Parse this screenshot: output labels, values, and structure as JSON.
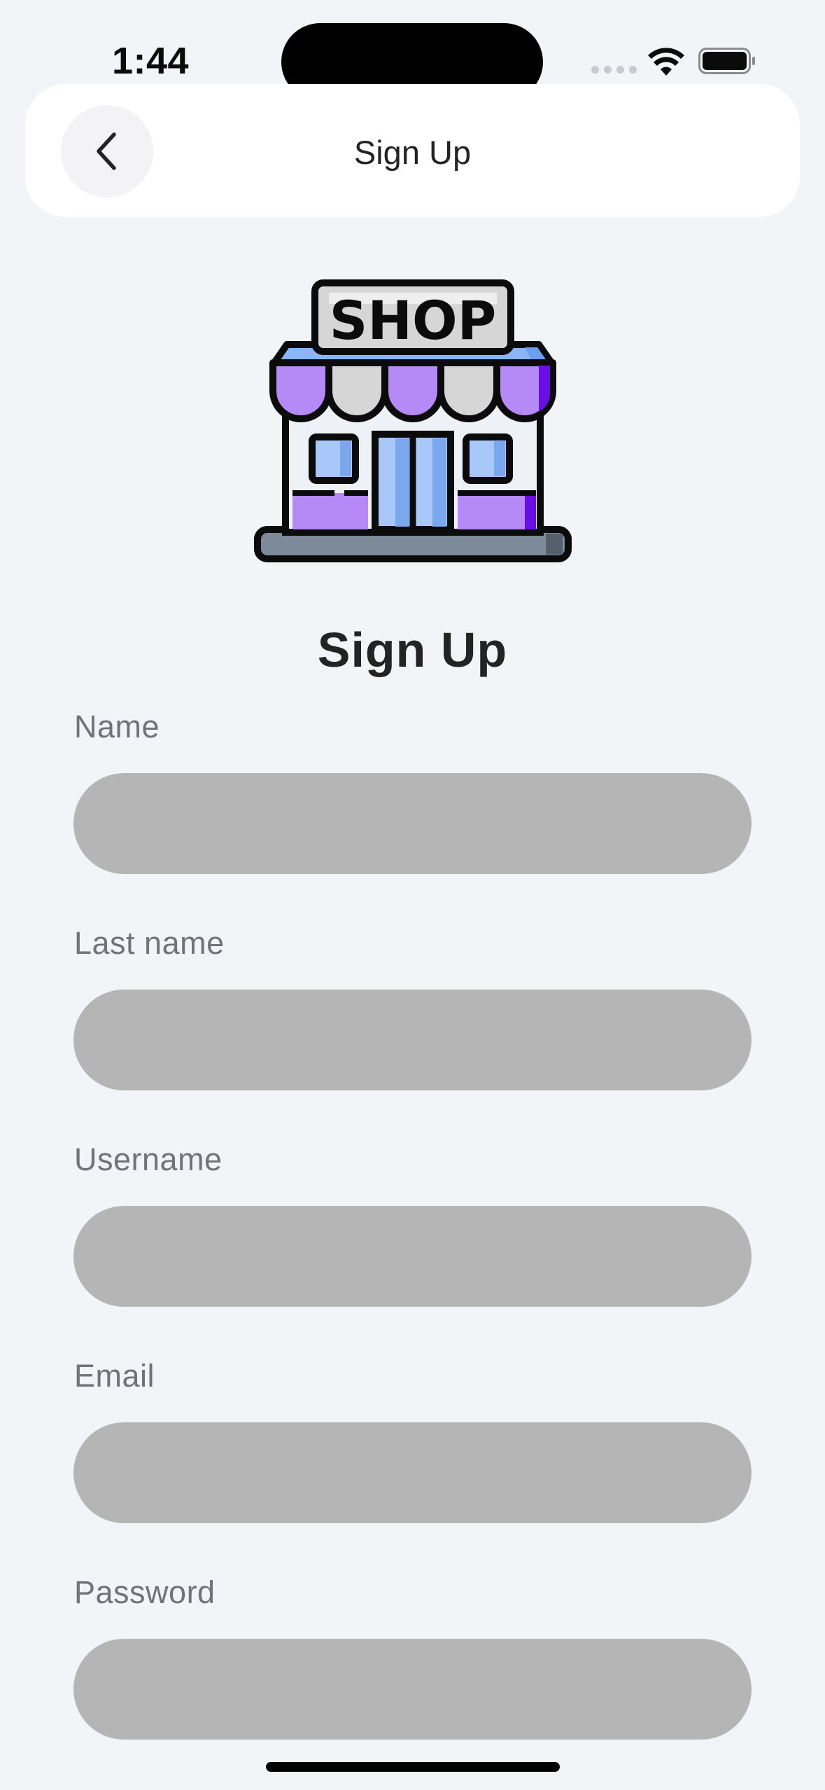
{
  "status_bar": {
    "time": "1:44"
  },
  "header": {
    "title": "Sign Up",
    "back_icon": "chevron-left-icon"
  },
  "logo": {
    "sign_text": "SHOP",
    "colors": {
      "awning_purple": "#b58af7",
      "awning_gray": "#d6d6d6",
      "roof_blue": "#8ab6f7",
      "window_blue": "#a7c8f8",
      "base_gray": "#7d8a99",
      "accent_violet": "#6a0ee8"
    }
  },
  "form": {
    "title": "Sign Up",
    "fields": [
      {
        "label": "Name",
        "value": ""
      },
      {
        "label": "Last name",
        "value": ""
      },
      {
        "label": "Username",
        "value": ""
      },
      {
        "label": "Email",
        "value": ""
      },
      {
        "label": "Password",
        "value": ""
      }
    ]
  },
  "colors": {
    "background": "#f3f4f8",
    "card": "#ffffff",
    "input_fill": "#b5b5b5",
    "label_text": "#727279",
    "primary_text": "#232323"
  }
}
